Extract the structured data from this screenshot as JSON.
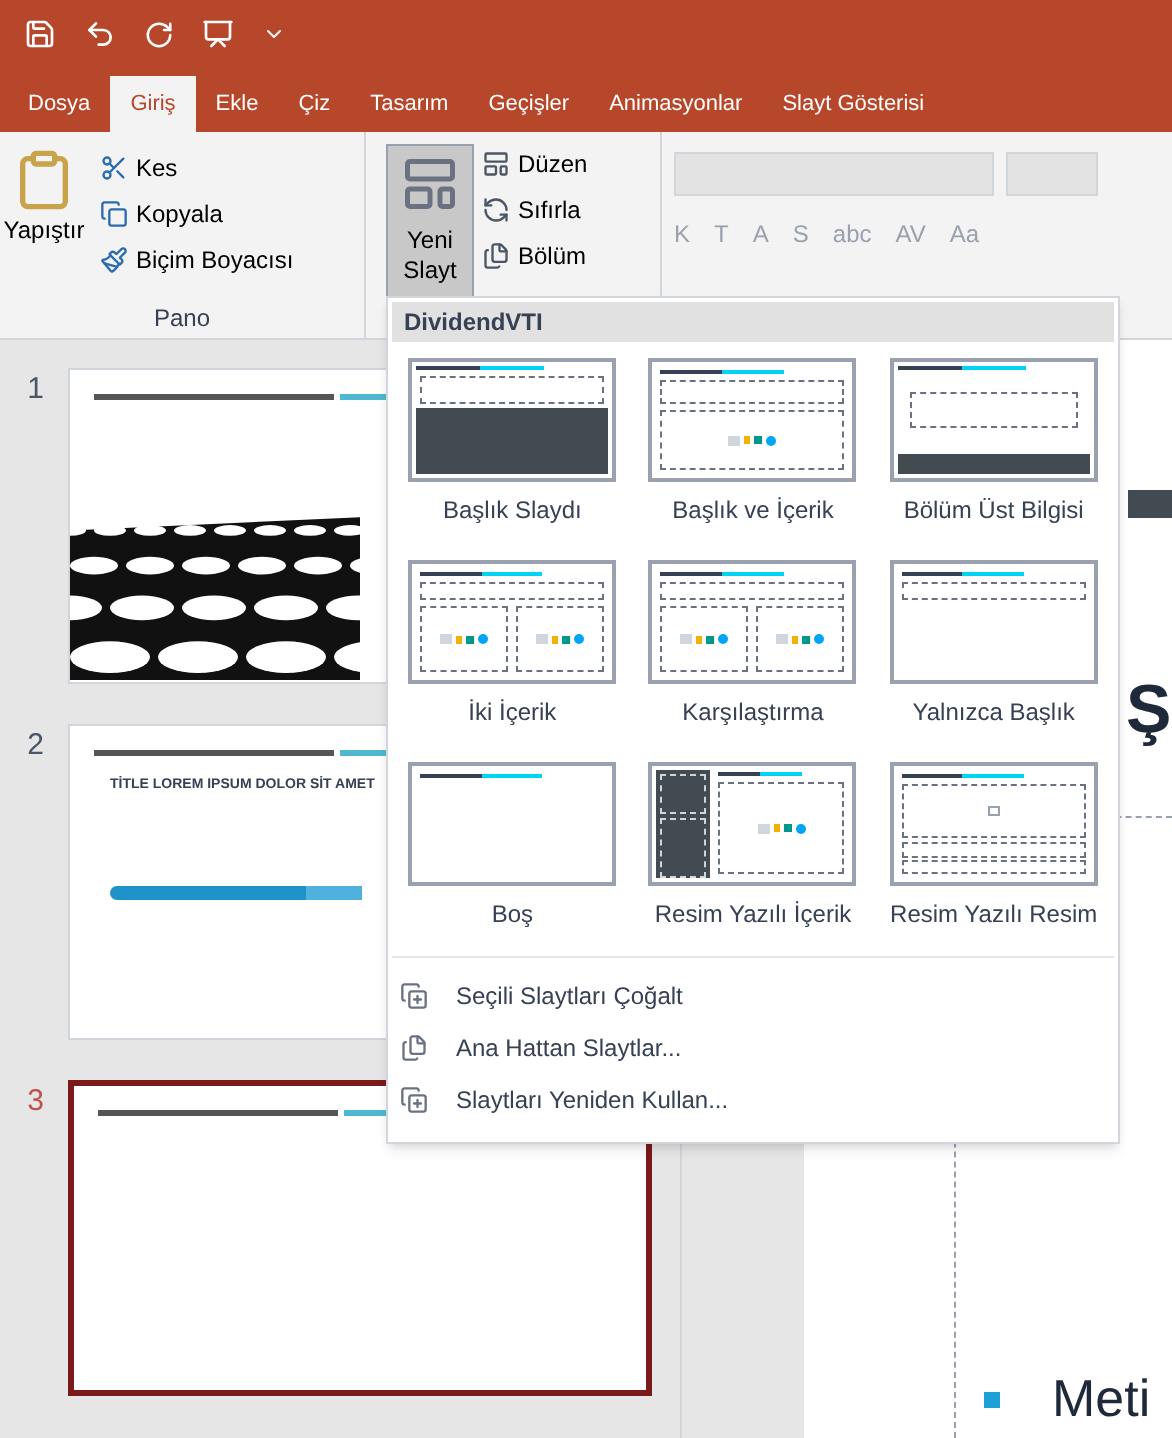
{
  "tabs": [
    {
      "label": "Dosya",
      "selected": false
    },
    {
      "label": "Giriş",
      "selected": true
    },
    {
      "label": "Ekle",
      "selected": false
    },
    {
      "label": "Çiz",
      "selected": false
    },
    {
      "label": "Tasarım",
      "selected": false
    },
    {
      "label": "Geçişler",
      "selected": false
    },
    {
      "label": "Animasyonlar",
      "selected": false
    },
    {
      "label": "Slayt Gösterisi",
      "selected": false
    }
  ],
  "clipboard": {
    "paste": "Yapıştır",
    "items": [
      "Kes",
      "Kopyala",
      "Biçim Boyacısı"
    ],
    "label": "Pano"
  },
  "slides_group": {
    "new_slide": "Yeni",
    "new_slide_2": "Slayt",
    "expanded": true,
    "items": [
      "Düzen",
      "Sıfırla",
      "Bölüm"
    ]
  },
  "font_buttons": [
    "K",
    "T",
    "A",
    "S",
    "abc",
    "AV",
    "Aa"
  ],
  "slides": [
    {
      "number": "1",
      "selected": false,
      "kind": "picture"
    },
    {
      "number": "2",
      "selected": false,
      "kind": "timeline",
      "title": "TİTLE LOREM IPSUM DOLOR SİT AMET"
    },
    {
      "number": "3",
      "selected": true,
      "kind": "blank"
    }
  ],
  "layout_menu": {
    "theme": "DividendVTI",
    "layouts": [
      {
        "label": "Başlık Slaydı",
        "kind": "title"
      },
      {
        "label": "Başlık ve İçerik",
        "kind": "title_content"
      },
      {
        "label": "Bölüm Üst Bilgisi",
        "kind": "section"
      },
      {
        "label": "İki İçerik",
        "kind": "two_content"
      },
      {
        "label": "Karşılaştırma",
        "kind": "comparison"
      },
      {
        "label": "Yalnızca Başlık",
        "kind": "title_only"
      },
      {
        "label": "Boş",
        "kind": "blank"
      },
      {
        "label": "Resim Yazılı İçerik",
        "kind": "content_caption"
      },
      {
        "label": "Resim Yazılı Resim",
        "kind": "picture_caption"
      }
    ],
    "items": [
      "Seçili Slaytları Çoğalt",
      "Ana Hattan Slaytlar...",
      "Slaytları Yeniden Kullan..."
    ]
  },
  "main_slide": {
    "title_fragment": "Ş",
    "bullet": "Meti"
  }
}
